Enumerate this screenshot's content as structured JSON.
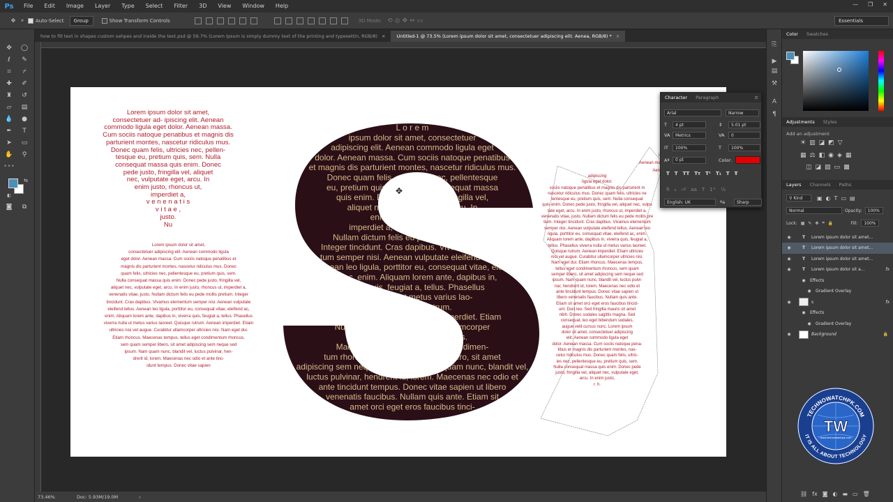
{
  "app": {
    "logo": "Ps",
    "menu": [
      "File",
      "Edit",
      "Image",
      "Layer",
      "Type",
      "Select",
      "Filter",
      "3D",
      "View",
      "Window",
      "Help"
    ],
    "window_controls": [
      "—",
      "❐",
      "✕"
    ]
  },
  "options": {
    "autoselect_label": "Auto-Select",
    "group_value": "Group",
    "transform_label": "Show Transform Controls",
    "mode_3d": "3D Mode:",
    "workspace": "Essentials"
  },
  "tabs": [
    {
      "label": "how to fill text in shapes custom sahpes and inside the text.psd @ 59.7% (Lorem Ipsum is simply dummy text of the printing and typesettin, RGB/8)",
      "close": "×",
      "active": false
    },
    {
      "label": "Untitled-1 @ 73.5% (Lorem ipsum dolor sit amet, consectetuer adipiscing elit. Aenea, RGB/8) *",
      "close": "×",
      "active": true
    }
  ],
  "canvas": {
    "heart_text": [
      "Lorem ipsum    dolor sit amet,",
      "consectetuer ad- ipiscing elit. Aenean",
      "commodo ligula eget dolor. Aenean massa.",
      "Cum sociis natoque penatibus et magnis dis",
      "parturient montes, nascetur ridiculus mus.",
      "Donec quam felis, ultricies nec, pellen-",
      "tesque eu, pretium quis, sem. Nulla",
      "consequat massa quis enim. Donec",
      "pede justo, fringilla vel, aliquet",
      "nec, vulputate eget, arcu. In",
      "enim justo, rhoncus ut,",
      "imperdiet a,",
      "v e n e n a t i s",
      "v i t a e ,",
      "justo.",
      "Nu"
    ],
    "para_text": [
      "Lorem ipsum dolor sit amet,",
      "consectetuer adipiscing elit. Aenean commodo ligula",
      "eget dolor. Aenean massa. Cum sociis natoque penatibus et",
      "magnis dis parturient montes, nascetur ridiculus mus. Donec",
      "quam felis, ultricies nec, pellentesque eu, pretium quis, sem.",
      "Nulla consequat massa quis enim. Donec pede justo, fringilla vel,",
      "aliquet nec, vulputate eget, arcu. In enim justo, rhoncus ut, imperdiet a,",
      "venenatis vitae, justo. Nullam dictum felis eu pede mollis pretium. Integer",
      "tincidunt. Cras dapibus. Vivamus elementum semper nisi. Aenean vulputate",
      "eleifend tellus. Aenean leo ligula, porttitor eu, consequat vitae, eleifend ac,",
      "enim. Aliquam lorem ante, dapibus in, viverra quis, feugiat a, tellus. Phasellus",
      "viverra nulla ut metus varius laoreet. Quisque rutrum. Aenean imperdiet. Etiam",
      "ultricies nisi vel augue. Curabitur ullamcorper ultricies nisi. Nam eget dui.",
      "Etiam rhoncus. Maecenas tempus, tellus eget condimentum rhoncus,",
      "sem quam semper libero, sit amet adipiscing sem neque sed",
      "ipsum. Nam quam nunc, blandit vel, luctus pulvinar, hen-",
      "drerit id, lorem. Maecenas nec odio et ante tinc-",
      "idunt tempus. Donec vitae sapien"
    ],
    "s_text": [
      "L o r e m",
      "ipsum dolor sit amet, consectetuer",
      "adipiscing elit. Aenean commodo ligula eget",
      "dolor. Aenean massa. Cum sociis natoque penatibus",
      "et magnis dis parturient montes, nascetur ridiculus mus.",
      "Donec quam felis, ul-                  tricies nec, pellentesque",
      "eu, pretium quis, sem.                    Nulla consequat massa",
      "quis enim. Donec                        pede justo, fringilla vel,",
      "aliquet nec, vulputate                        eget, arcu. In",
      "enim justo, rhoncus ut,",
      "imperdiet a, venenatis vitae, justo.",
      "Nullam dictum felis eu pede mollis pretium.",
      "Integer tincidunt. Cras dapibus. Vivamus elemen-",
      "tum semper nisi. Aenean vulputate eleifend tellus.",
      "Aenean leo ligula, porttitor eu, consequat vitae, eleif-",
      "end ac, enim. Aliquam lorem ante, dapibus in,",
      "viverra quis, feugiat a, tellus. Phasellus",
      "viverra nulla ut metus varius lao-",
      "reet. Quisque rutrum.",
      "ultricies nisi vel augue.              Aenean imperdiet. Etiam",
      "Nullam dictum felis.              Curabitur ullamcorper",
      "Nam eget                         dui. Etiam rhoncus.",
      "Maecenas tempus,              tellus eget condimen-",
      "tum rhoncus, sem quam                 semper libero, sit amet",
      "adipiscing sem neque sed ipsum. Nam quam nunc, blandit vel,",
      "luctus pulvinar, hendrerit id, lorem. Maecenas nec odio et",
      "ante tincidunt tempus. Donec vitae sapien ut libero",
      "venenatis faucibus. Nullam quis ante. Etiam sit",
      "amet orci eget eros faucibus tinci-"
    ],
    "y_text": [
      "adipiscing",
      "ligula eget dolor.",
      "sociis natoque penatibus et magnis dis parturient m",
      "nascetur ridiculus mus. Donec quam felis, ultricies ne",
      "lentesque eu, pretium quis, sem. Nulla consequat",
      "quis enim. Donec pede justo, fringilla vel, aliquet nec, vulpu",
      "tate eget, arcu. In enim justo, rhoncus ut, imperdiet a,",
      "venenatis vitae, justo. Nullam dictum felis eu pede mollis pre",
      "tium. Integer tincidunt. Cras dapibus. Vivamus elementum",
      "semper nisi. Aenean vulputate eleifend tellus. Aenean leo",
      "ligula, porttitor eu, consequat vitae, eleifend ac, enim.",
      "Aliquam lorem ante, dapibus in, viverra quis, feugiat a,",
      "tellus. Phasellus viverra nulla ut metus varius laoreet.",
      "Quisque rutrum. Aenean imperdiet. Etiam ultricies",
      "nisi vel augue. Curabitur ullamcorper ultricies nisi.",
      "Nam eget dui. Etiam rhoncus. Maecenas tempus,",
      "tellus eget condimentum rhoncus, sem quam",
      "semper libero, sit amet adipiscing sem neque sed",
      "ipsum. Nam quam nunc, blandit vel, luctus pulvi-",
      "nar, hendrerit id, lorem. Maecenas nec odio et",
      "ante tincidunt tempus. Donec vitae sapien ut",
      "libero venenatis faucibus. Nullam quis ante.",
      "Etiam sit amet orci eget eros faucibus tincid-",
      "unt. Duis leo. Sed fringilla mauris sit amet",
      "nibh. Donec sodales sagittis magna. Sed",
      "consequat, leo eget bibendum sodales,",
      "augue velit cursus nunc. Lorem ipsum",
      "dolor sit amet, consectetuer adipiscing",
      "elit. Aenean commodo ligula eget",
      "dolor. Aenean massa. Cum sociis natoque pena-",
      "tibus et magnis dis parturient montes, nas-",
      "cetur ridiculus mus. Donec quam felis, ultric-",
      "ies nec, pellentesque eu, pretium quis, sem.",
      "Nulla consequat massa quis enim. Donec pede",
      "justo, fringilla vel, aliquet nec, vulputate eget,",
      "arcu. In enim justo,",
      "r. h."
    ],
    "y_text_right": [
      "Lore",
      "Aenean massa.",
      "Aenean"
    ]
  },
  "status": {
    "zoom": "73.46%",
    "doc": "Doc: 5.93M/19.0M",
    "arrow": "›"
  },
  "color_panel": {
    "tabs": [
      "Color",
      "Swatches"
    ]
  },
  "adjustments": {
    "tabs": [
      "Adjustments",
      "Styles"
    ],
    "hint": "Add an adjustment"
  },
  "layers_panel": {
    "tabs": [
      "Layers",
      "Channels",
      "Paths"
    ],
    "kind": "Kind",
    "blend": "Normal",
    "opacity_label": "Opacity:",
    "opacity": "100%",
    "lock_label": "Lock:",
    "fill_label": "Fill:",
    "fill": "100%",
    "layers": [
      {
        "name": "Lorem ipsum dolor sit amet...",
        "type": "T"
      },
      {
        "name": "Lorem ipsum dolor sit amet...",
        "type": "T",
        "selected": true
      },
      {
        "name": "Lorem ipsum dolor sit amet...",
        "type": "T"
      },
      {
        "name": "Lorem ipsum dolor sit a...",
        "type": "T",
        "fx": "fx"
      },
      {
        "name": "Effects",
        "type": "sub"
      },
      {
        "name": "Gradient Overlay",
        "type": "sub2"
      },
      {
        "name": "s",
        "type": "img",
        "fx": "fx"
      },
      {
        "name": "Effects",
        "type": "sub"
      },
      {
        "name": "Gradient Overlay",
        "type": "sub2"
      },
      {
        "name": "Background",
        "type": "bg"
      }
    ]
  },
  "character": {
    "tabs": [
      "Character",
      "Paragraph"
    ],
    "font": "Arial",
    "style": "Narrow",
    "size": "4 pt",
    "leading": "5.01 pt",
    "kerning": "Metrics",
    "tracking": "0",
    "vscale": "100%",
    "hscale": "100%",
    "baseline": "0 pt",
    "color_label": "Color:",
    "color": "#e40000",
    "language": "English: UK",
    "aa_icon": "ªa",
    "antialias": "Sharp"
  },
  "watermark": {
    "brand": "TECHNOWATCHPK.COM",
    "tagline": "IT IS ALL ABOUT TECHNOLOGY",
    "url": "www.technowatchpk.com",
    "logo": "TW"
  },
  "colors": {
    "accent": "#3aa0e6",
    "s_fill": "#2a0f17",
    "s_text": "#d9b98a",
    "red_text": "#b11d2b",
    "fg": "#4a8fb8"
  }
}
